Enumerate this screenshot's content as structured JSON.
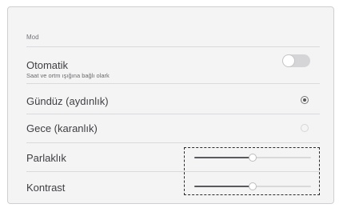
{
  "section": {
    "title": "Mod"
  },
  "auto": {
    "label": "Otomatik",
    "description": "Saat ve ortm ışığına bağlı olark",
    "enabled": false
  },
  "modes": [
    {
      "label": "Gündüz (aydınlık)",
      "selected": true
    },
    {
      "label": "Gece (karanlık)",
      "selected": false
    }
  ],
  "sliders": [
    {
      "label": "Parlaklık",
      "value": 0.5
    },
    {
      "label": "Kontrast",
      "value": 0.5
    }
  ],
  "colors": {
    "accent": "#5a5a5e",
    "panel": "#f4f4f5",
    "text": "#3f3f43"
  }
}
